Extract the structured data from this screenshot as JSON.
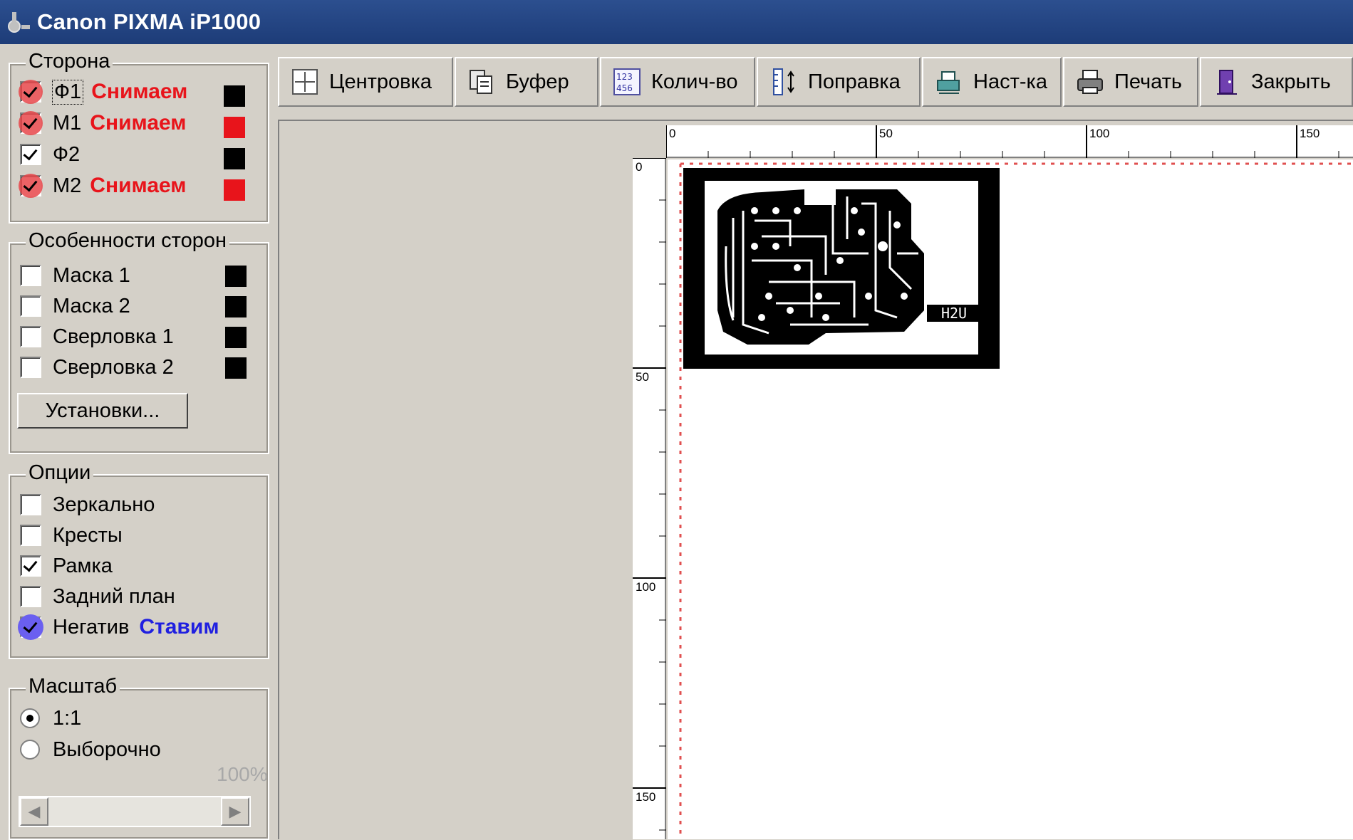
{
  "window": {
    "title": "Canon PIXMA iP1000"
  },
  "side_group": {
    "title": "Сторона",
    "items": [
      {
        "label": "Ф1",
        "note": "Снимаем",
        "checked": true,
        "swatch": "#000000"
      },
      {
        "label": "М1",
        "note": "Снимаем",
        "checked": true,
        "swatch": "#e8141b"
      },
      {
        "label": "Ф2",
        "note": "",
        "checked": true,
        "swatch": "#000000"
      },
      {
        "label": "М2",
        "note": "Снимаем",
        "checked": true,
        "swatch": "#e8141b"
      }
    ]
  },
  "features_group": {
    "title": "Особенности сторон",
    "items": [
      {
        "label": "Маска 1",
        "checked": false,
        "swatch": "#000000"
      },
      {
        "label": "Маска 2",
        "checked": false,
        "swatch": "#000000"
      },
      {
        "label": "Сверловка 1",
        "checked": false,
        "swatch": "#000000"
      },
      {
        "label": "Сверловка 2",
        "checked": false,
        "swatch": "#000000"
      }
    ],
    "settings_button": "Установки..."
  },
  "options_group": {
    "title": "Опции",
    "items": [
      {
        "label": "Зеркально",
        "checked": false
      },
      {
        "label": "Кресты",
        "checked": false
      },
      {
        "label": "Рамка",
        "checked": true
      },
      {
        "label": "Задний план",
        "checked": false
      },
      {
        "label": "Негатив",
        "note": "Ставим",
        "checked": true
      }
    ]
  },
  "scale_group": {
    "title": "Масштаб",
    "options": [
      {
        "label": "1:1",
        "selected": true
      },
      {
        "label": "Выборочно",
        "selected": false
      }
    ],
    "percent": "100%"
  },
  "toolbar": {
    "buttons": [
      {
        "label": "Центровка",
        "icon": "center-icon"
      },
      {
        "label": "Буфер",
        "icon": "clipboard-icon"
      },
      {
        "label": "Колич-во",
        "icon": "quantity-icon"
      },
      {
        "label": "Поправка",
        "icon": "correction-icon"
      },
      {
        "label": "Наст-ка",
        "icon": "printer-setup-icon"
      },
      {
        "label": "Печать",
        "icon": "printer-icon"
      },
      {
        "label": "Закрыть",
        "icon": "exit-door-icon"
      }
    ]
  },
  "ruler": {
    "top_labels": [
      "0",
      "50",
      "100",
      "150"
    ],
    "left_labels": [
      "0",
      "50",
      "100",
      "150"
    ]
  },
  "board": {
    "label": "H2U"
  }
}
